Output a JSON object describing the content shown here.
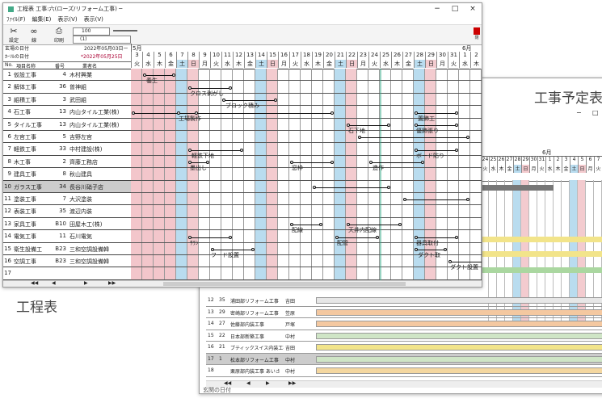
{
  "back_window": {
    "title": "工事予定表",
    "win_buttons": [
      "−",
      "□"
    ],
    "month_label": "6月",
    "day_numbers": [
      "24",
      "25",
      "26",
      "27",
      "28",
      "29",
      "30",
      "31",
      "1",
      "2",
      "3",
      "4",
      "5",
      "6",
      "7",
      "8"
    ],
    "weekdays": [
      "火",
      "水",
      "木",
      "金",
      "土",
      "日",
      "月",
      "火",
      "水",
      "木",
      "金",
      "土",
      "日",
      "月",
      "火",
      "水"
    ],
    "rows": [
      {
        "num": "12",
        "code": "35",
        "name": "浦田部リフォーム工事",
        "person": "吉田"
      },
      {
        "num": "13",
        "code": "29",
        "name": "密崎部リフォーム工事",
        "person": "笠原"
      },
      {
        "num": "14",
        "code": "27",
        "name": "佐藤部内装工事",
        "person": "戸塚"
      },
      {
        "num": "15",
        "code": "22",
        "name": "日本部新築工事",
        "person": "中村"
      },
      {
        "num": "16",
        "code": "21",
        "name": "ブティックスイス内装工事",
        "person": "吉田"
      },
      {
        "num": "17",
        "code": "1",
        "name": "松本部リフォーム工事",
        "person": "中村"
      },
      {
        "num": "18",
        "code": "",
        "name": "栗原部内装工事 あいさ",
        "person": "中村"
      }
    ],
    "nav": [
      "◀◀",
      "◀",
      "▶",
      "▶▶"
    ],
    "status": "玄関の日付"
  },
  "front_window": {
    "title": "工程表 工事:六(ローズ/リフォーム工事) ─",
    "win_buttons": [
      "−",
      "□",
      "×"
    ],
    "menu": [
      "ﾌｧｲﾙ(F)",
      "編集(E)",
      "表示(V)",
      "表示(V)"
    ],
    "toolbar": {
      "setting": "設定",
      "link": "線",
      "print": "印刷",
      "zoom": "100",
      "close": "閉",
      "color_value": "(1)"
    },
    "date_left_label": "玄場の日付",
    "date_left_value": "2022年05月03日ー",
    "cursor_label": "ｶｰｿﾙの日付",
    "cursor_value": "*2022年05月25日",
    "col_headers": {
      "no": "No.",
      "name": "項目名称",
      "code": "番号",
      "org": "業者名"
    },
    "month_label": "5月",
    "month_label2": "6月",
    "day_numbers": [
      "3",
      "4",
      "5",
      "6",
      "7",
      "8",
      "9",
      "10",
      "11",
      "12",
      "13",
      "14",
      "15",
      "16",
      "17",
      "18",
      "19",
      "20",
      "21",
      "22",
      "23",
      "24",
      "25",
      "26",
      "27",
      "28",
      "29",
      "30",
      "31",
      "1",
      "2"
    ],
    "weekdays": [
      "火",
      "水",
      "木",
      "金",
      "土",
      "日",
      "月",
      "火",
      "水",
      "木",
      "金",
      "土",
      "日",
      "月",
      "火",
      "水",
      "木",
      "金",
      "土",
      "日",
      "月",
      "火",
      "水",
      "木",
      "金",
      "土",
      "日",
      "月",
      "火",
      "水",
      "木"
    ],
    "rows": [
      {
        "num": "1",
        "name": "仮設工事",
        "code": "4",
        "org": "木村興業"
      },
      {
        "num": "2",
        "name": "解体工事",
        "code": "36",
        "org": "曽神組"
      },
      {
        "num": "3",
        "name": "組積工事",
        "code": "3",
        "org": "武田組"
      },
      {
        "num": "4",
        "name": "石工事",
        "code": "13",
        "org": "内山タイル工業(株)"
      },
      {
        "num": "5",
        "name": "タイル工事",
        "code": "13",
        "org": "内山タイル工業(株)"
      },
      {
        "num": "6",
        "name": "左官工事",
        "code": "5",
        "org": "吉野左官"
      },
      {
        "num": "7",
        "name": "軽鉄工事",
        "code": "33",
        "org": "中村建設(株)"
      },
      {
        "num": "8",
        "name": "木工事",
        "code": "2",
        "org": "齊藤工務店"
      },
      {
        "num": "9",
        "name": "建具工事",
        "code": "8",
        "org": "秋山建具"
      },
      {
        "num": "10",
        "name": "ガラス工事",
        "code": "34",
        "org": "長谷川硝子店"
      },
      {
        "num": "11",
        "name": "塗装工事",
        "code": "7",
        "org": "大沢塗装"
      },
      {
        "num": "12",
        "name": "表装工事",
        "code": "35",
        "org": "渡辺内装"
      },
      {
        "num": "13",
        "name": "家具工事",
        "code": "B10",
        "org": "田屋木工(株)"
      },
      {
        "num": "14",
        "name": "電気工事",
        "code": "11",
        "org": "石川電気"
      },
      {
        "num": "15",
        "name": "衛生設備工",
        "code": "B23",
        "org": "三和空調設備韓"
      },
      {
        "num": "16",
        "name": "空調工事",
        "code": "B23",
        "org": "三和空調設備韓"
      },
      {
        "num": "17",
        "name": "",
        "code": "",
        "org": ""
      }
    ],
    "task_labels": {
      "yojo": "養生",
      "cross": "クロス剥がし",
      "block": "ブロック積み",
      "koba": "工場製作",
      "kazari": "置飾工",
      "haridaku": "優飾張り",
      "ishitachi": "石下地",
      "keitetsu": "軽鉄下地",
      "board": "ボード貼り",
      "sumidashi": "墨出し",
      "madowaku": "窓枠",
      "zosaku": "造作",
      "haisen": "配線",
      "tenjo": "天井内配線",
      "kyuhai": "器具取付",
      "saran": "ｻﾗﾝ",
      "haikan": "配管",
      "duct": "ダクト設置",
      "hood": "フード設置",
      "duct2": "ダクト取"
    },
    "nav": [
      "◀◀",
      "◀",
      "▶",
      "▶▶"
    ]
  },
  "big_label_left": "工程表"
}
